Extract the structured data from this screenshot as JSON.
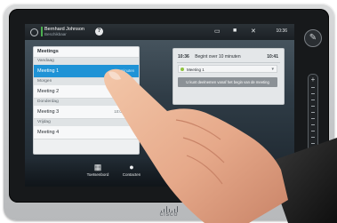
{
  "status_bar": {
    "user_name": "Bernhard Johnson",
    "user_sub": "Beschikbaar",
    "help_label": "?",
    "time": "10:36"
  },
  "meetings": {
    "title": "Meetings",
    "groups": [
      {
        "label": "Vandaag",
        "items": [
          {
            "name": "Meeting 1",
            "time": "",
            "selected": true
          }
        ]
      },
      {
        "label": "Morgen",
        "items": [
          {
            "name": "Meeting 2",
            "time": ""
          }
        ]
      },
      {
        "label": "Donderdag",
        "items": [
          {
            "name": "Meeting 3",
            "time": "10:00-11:00"
          }
        ]
      },
      {
        "label": "Vrijdag",
        "items": [
          {
            "name": "Meeting 4",
            "time": ""
          }
        ]
      }
    ],
    "selected_partial_text": "n minuten"
  },
  "detail": {
    "start_time": "10:36",
    "begin_text": "Begint over 10 minuten",
    "end_time": "10:41",
    "meeting_name": "Meeting 1",
    "notice": "U kunt deelnemen vanaf het begin van de meeting"
  },
  "tray": {
    "items": [
      {
        "label": "Toetsenbord",
        "icon": "keypad-icon"
      },
      {
        "label": "Contacten",
        "icon": "contacts-icon"
      }
    ]
  },
  "brand": {
    "logo_text": "CISCO"
  },
  "colors": {
    "selected_row": "#1f93d6",
    "status_available": "#4caf50"
  }
}
